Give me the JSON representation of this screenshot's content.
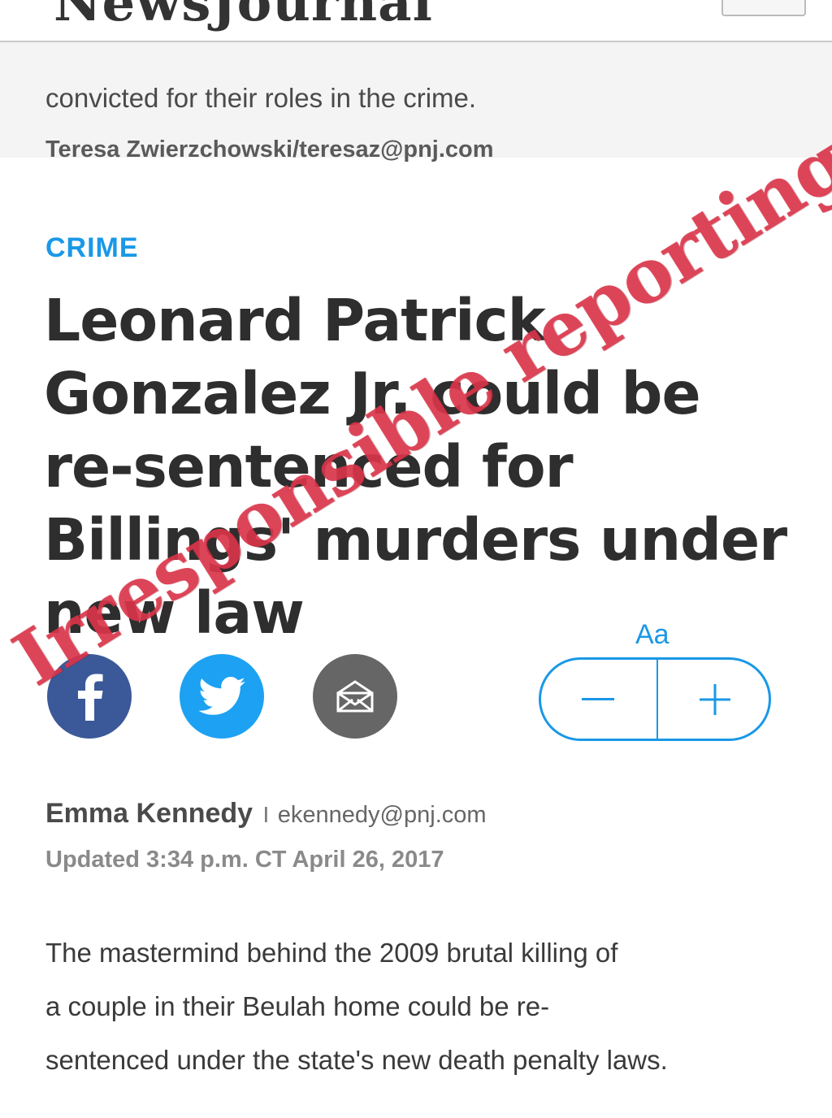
{
  "masthead": {
    "logo_text": "NewsJournal"
  },
  "caption": {
    "text": "convicted for their roles in the crime.",
    "credit": "Teresa Zwierzchowski/teresaz@pnj.com"
  },
  "article": {
    "section": "CRIME",
    "headline": "Leonard Patrick Gonzalez Jr. could be re-sentenced for Billings' murders under new law",
    "author": "Emma Kennedy",
    "separator": "I",
    "author_email": "ekennedy@pnj.com",
    "updated": "Updated 3:34 p.m. CT April 26, 2017",
    "body_line_1": "The mastermind behind the 2009 brutal killing of",
    "body_line_2": "a couple in their Beulah home could be re-",
    "body_line_3": "sentenced under the state's new death penalty laws."
  },
  "share": {
    "facebook_icon": "facebook-icon",
    "twitter_icon": "twitter-icon",
    "email_icon": "email-icon"
  },
  "font_control": {
    "label": "Aa",
    "decrease_icon": "minus-icon",
    "increase_icon": "plus-icon"
  },
  "overlay": {
    "stamp_text": "Irresponsible reporting"
  },
  "colors": {
    "accent": "#1a98e6",
    "facebook": "#3b5998",
    "twitter": "#1da1f2",
    "email": "#666666",
    "stamp": "#dc354a"
  }
}
